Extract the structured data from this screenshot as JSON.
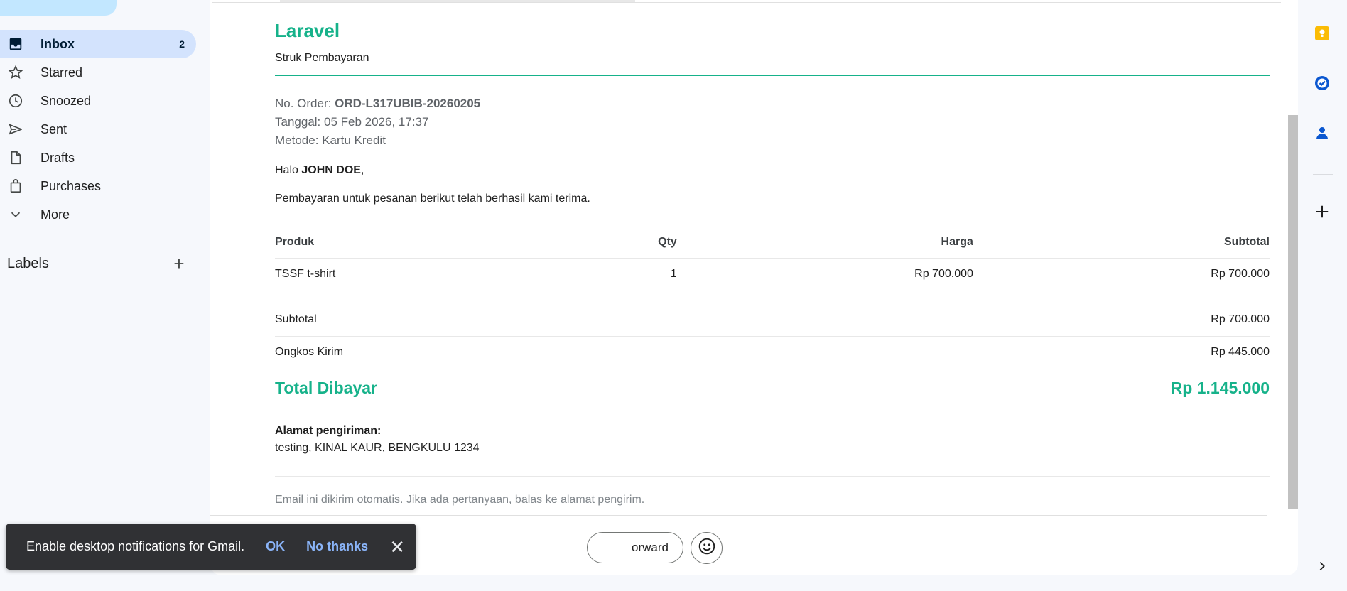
{
  "sidebar": {
    "items": [
      {
        "label": "Inbox",
        "count": "2",
        "icon": "inbox-icon"
      },
      {
        "label": "Starred",
        "icon": "star-icon"
      },
      {
        "label": "Snoozed",
        "icon": "clock-icon"
      },
      {
        "label": "Sent",
        "icon": "send-icon"
      },
      {
        "label": "Drafts",
        "icon": "draft-icon"
      },
      {
        "label": "Purchases",
        "icon": "bag-icon"
      },
      {
        "label": "More",
        "icon": "chevron-down-icon"
      }
    ],
    "labels_title": "Labels"
  },
  "email": {
    "brand": "Laravel",
    "subtitle": "Struk Pembayaran",
    "order_label": "No. Order:",
    "order_no": "ORD-L317UBIB-20260205",
    "date_line": "Tanggal: 05 Feb 2026, 17:37",
    "method_line": "Metode: Kartu Kredit",
    "greeting_prefix": "Halo",
    "customer_name": "JOHN DOE",
    "greeting_suffix": ",",
    "paid_text": "Pembayaran untuk pesanan berikut telah berhasil kami terima.",
    "table": {
      "headers": [
        "Produk",
        "Qty",
        "Harga",
        "Subtotal"
      ],
      "rows": [
        [
          "TSSF t-shirt",
          "1",
          "Rp 700.000",
          "Rp 700.000"
        ]
      ]
    },
    "subtotal_label": "Subtotal",
    "subtotal_value": "Rp 700.000",
    "shipping_label": "Ongkos Kirim",
    "shipping_value": "Rp 445.000",
    "total_label": "Total Dibayar",
    "total_value": "Rp 1.145.000",
    "address_title": "Alamat pengiriman:",
    "address": "testing, KINAL KAUR, BENGKULU 1234",
    "footnote": "Email ini dikirim otomatis. Jika ada pertanyaan, balas ke alamat pengirim."
  },
  "actions": {
    "forward_label": "orward"
  },
  "snackbar": {
    "message": "Enable desktop notifications for Gmail.",
    "ok": "OK",
    "no_thanks": "No thanks"
  },
  "colors": {
    "accent_green": "#16b28a",
    "inbox_active": "#d3e3fd",
    "keep_yellow": "#fbbc04",
    "tasks_blue": "#0b57d0"
  }
}
